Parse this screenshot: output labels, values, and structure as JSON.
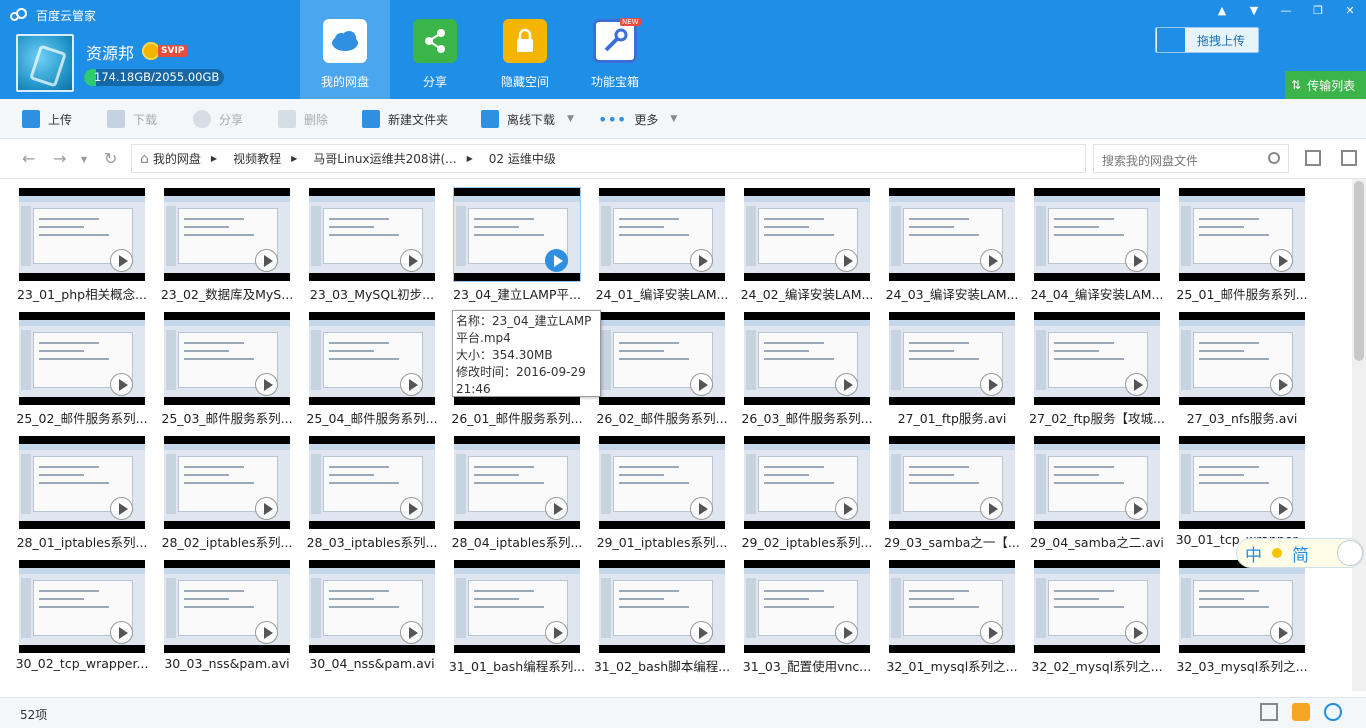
{
  "app": {
    "title": "百度云管家"
  },
  "user": {
    "name": "资源邦",
    "vip_tag": "SVIP",
    "quota_text": "174.18GB/2055.00GB",
    "quota_used_fraction": 0.0848
  },
  "nav_tabs": [
    {
      "label": "我的网盘",
      "icon": "cloud-drive-icon",
      "active": true
    },
    {
      "label": "分享",
      "icon": "share-icon",
      "active": false
    },
    {
      "label": "隐藏空间",
      "icon": "lock-icon",
      "active": false
    },
    {
      "label": "功能宝箱",
      "icon": "wrench-icon",
      "active": false,
      "badge": "NEW"
    }
  ],
  "window_controls": [
    "bell-icon",
    "menu-icon",
    "minimize-icon",
    "maximize-icon",
    "close-icon"
  ],
  "drag_upload_label": "拖拽上传",
  "transfer_list_label": "传输列表",
  "toolbar": {
    "upload": "上传",
    "download": "下载",
    "share": "分享",
    "delete": "删除",
    "new_folder": "新建文件夹",
    "offline_download": "离线下载",
    "more": "更多"
  },
  "breadcrumb": [
    "我的网盘",
    "视频教程",
    "马哥Linux运维共208讲(...",
    "02 运维中级"
  ],
  "search_placeholder": "搜索我的网盘文件",
  "files": [
    "23_01_php相关概念...",
    "23_02_数据库及MyS...",
    "23_03_MySQL初步...",
    "23_04_建立LAMP平...",
    "24_01_编译安装LAM...",
    "24_02_编译安装LAM...",
    "24_03_编译安装LAM...",
    "24_04_编译安装LAM...",
    "25_01_邮件服务系列...",
    "25_02_邮件服务系列...",
    "25_03_邮件服务系列...",
    "25_04_邮件服务系列...",
    "26_01_邮件服务系列...",
    "26_02_邮件服务系列...",
    "26_03_邮件服务系列...",
    "27_01_ftp服务.avi",
    "27_02_ftp服务【攻城...",
    "27_03_nfs服务.avi",
    "28_01_iptables系列...",
    "28_02_iptables系列...",
    "28_03_iptables系列...",
    "28_04_iptables系列...",
    "29_01_iptables系列...",
    "29_02_iptables系列...",
    "29_03_samba之一【...",
    "29_04_samba之二.avi",
    "30_01_tcp_wrapper...",
    "30_02_tcp_wrapper...",
    "30_03_nss&pam.avi",
    "30_04_nss&pam.avi",
    "31_01_bash编程系列...",
    "31_02_bash脚本编程...",
    "31_03_配置使用vnc...",
    "32_01_mysql系列之...",
    "32_02_mysql系列之...",
    "32_03_mysql系列之..."
  ],
  "hovered_index": 3,
  "tooltip": {
    "name": "名称：23_04_建立LAMP平台.mp4",
    "size": "大小：354.30MB",
    "modified": "修改时间：2016-09-29 21:46"
  },
  "ime": {
    "lang": "中",
    "mode": "简"
  },
  "status": {
    "count": "52项"
  }
}
